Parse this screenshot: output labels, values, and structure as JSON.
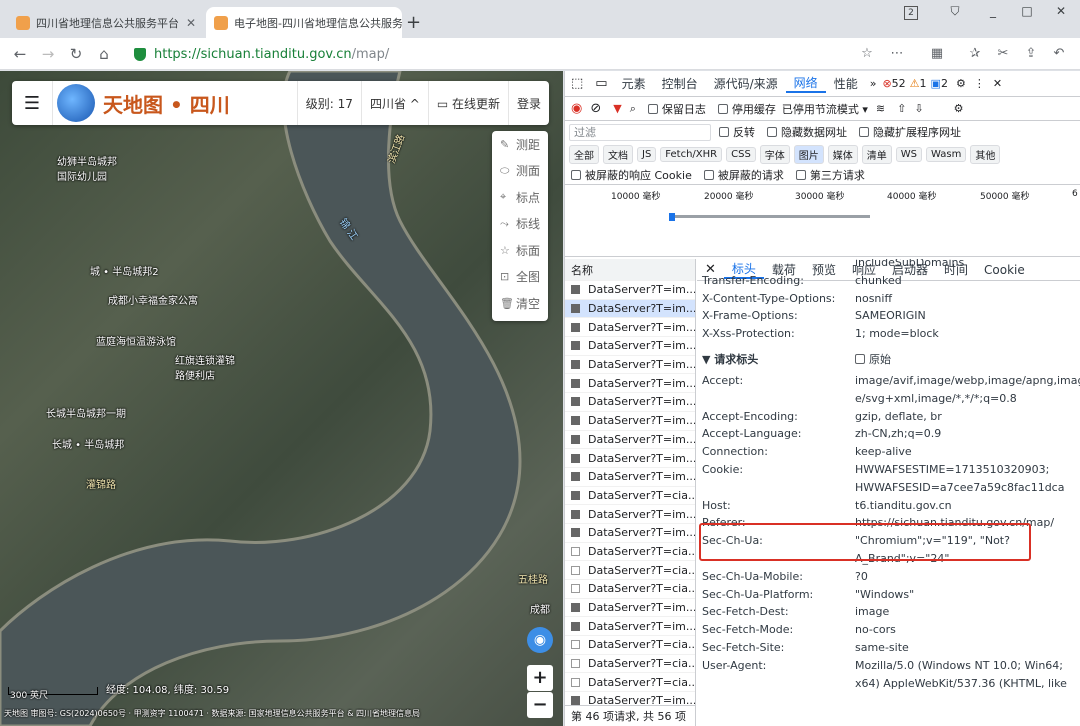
{
  "browser": {
    "tabs": [
      {
        "title": "四川省地理信息公共服务平台",
        "close": "✕"
      },
      {
        "title": "电子地图-四川省地理信息公共服务",
        "close": "✕"
      }
    ],
    "new_tab": "+",
    "url_scheme": "https://",
    "url_host": "sichuan.tianditu.gov.cn",
    "url_path": "/map/",
    "window_buttons": [
      "2",
      "_",
      "□",
      "✕"
    ]
  },
  "map": {
    "logo_text": "天地图 • 四川",
    "level_label": "级别: 17",
    "region": "四川省 ^",
    "update_button": "在线更新",
    "login_button": "登录",
    "tools": [
      "测距",
      "测面",
      "标点",
      "标线",
      "标面",
      "全图",
      "清空"
    ],
    "labels": [
      {
        "t": "幼狮半岛城邦",
        "c": "place"
      },
      {
        "t": "国际幼儿园",
        "c": "place"
      },
      {
        "t": "城 • 半岛城邦2",
        "c": "place"
      },
      {
        "t": "成都小幸福金家公寓",
        "c": "place"
      },
      {
        "t": "蓝庭海恒温游泳馆",
        "c": "place"
      },
      {
        "t": "红旗连锁灌锦",
        "c": "place"
      },
      {
        "t": "路便利店",
        "c": "place"
      },
      {
        "t": "长城半岛城邦一期",
        "c": "place"
      },
      {
        "t": "长城 • 半岛城邦",
        "c": "place"
      },
      {
        "t": "灌锦路",
        "c": "road"
      },
      {
        "t": "锦 江",
        "c": "road"
      },
      {
        "t": "滨江路",
        "c": "road"
      },
      {
        "t": "五桂路",
        "c": "road"
      },
      {
        "t": "成都",
        "c": "place"
      }
    ],
    "scale": "300 英尺",
    "coords": "经度: 104.08, 纬度: 30.59",
    "footer": "天地图 审图号: GS(2024)0650号 · 甲测资字 1100471 · 数据来源: 国家地理信息公共服务平台 & 四川省地理信息局",
    "zoom_in": "+",
    "zoom_out": "−"
  },
  "devtools": {
    "tabs": [
      "元素",
      "控制台",
      "源代码/来源",
      "网络",
      "性能"
    ],
    "active_tab": "网络",
    "badges": {
      "errors": "52",
      "warnings": "1",
      "info": "2"
    },
    "toolbar": {
      "preserve_log": "保留日志",
      "disable_cache": "停用缓存",
      "throttling": "已停用节流模式"
    },
    "filter_placeholder": "过滤",
    "filter_checks": [
      "反转",
      "隐藏数据网址",
      "隐藏扩展程序网址"
    ],
    "type_filters": [
      "全部",
      "文档",
      "JS",
      "Fetch/XHR",
      "CSS",
      "字体",
      "图片",
      "媒体",
      "清单",
      "WS",
      "Wasm",
      "其他"
    ],
    "active_type": "图片",
    "more_checks": [
      "被屏蔽的响应 Cookie",
      "被屏蔽的请求",
      "第三方请求"
    ],
    "timeline_ticks": [
      "10000 毫秒",
      "20000 毫秒",
      "30000 毫秒",
      "40000 毫秒",
      "50000 毫秒",
      "6"
    ],
    "name_header": "名称",
    "requests": [
      "DataServer?T=im...",
      "DataServer?T=im...",
      "DataServer?T=im...",
      "DataServer?T=im...",
      "DataServer?T=im...",
      "DataServer?T=im...",
      "DataServer?T=im...",
      "DataServer?T=im...",
      "DataServer?T=im...",
      "DataServer?T=im...",
      "DataServer?T=im...",
      "DataServer?T=cia...",
      "DataServer?T=im...",
      "DataServer?T=im...",
      "DataServer?T=cia...",
      "DataServer?T=cia...",
      "DataServer?T=cia...",
      "DataServer?T=im...",
      "DataServer?T=im...",
      "DataServer?T=cia...",
      "DataServer?T=cia...",
      "DataServer?T=cia...",
      "DataServer?T=im..."
    ],
    "detail_tabs": [
      "标头",
      "载荷",
      "预览",
      "响应",
      "启动器",
      "时间",
      "Cookie"
    ],
    "active_detail_tab": "标头",
    "response_headers": [
      {
        "k": "",
        "v": "includeSubDomains"
      },
      {
        "k": "Transfer-Encoding:",
        "v": "chunked"
      },
      {
        "k": "X-Content-Type-Options:",
        "v": "nosniff"
      },
      {
        "k": "X-Frame-Options:",
        "v": "SAMEORIGIN"
      },
      {
        "k": "X-Xss-Protection:",
        "v": "1; mode=block"
      }
    ],
    "request_section": "▼ 请求标头",
    "raw_label": "原始",
    "request_headers": [
      {
        "k": "Accept:",
        "v": "image/avif,image/webp,image/apng,imag",
        "v2": "e/svg+xml,image/*,*/*;q=0.8"
      },
      {
        "k": "Accept-Encoding:",
        "v": "gzip, deflate, br"
      },
      {
        "k": "Accept-Language:",
        "v": "zh-CN,zh;q=0.9"
      },
      {
        "k": "Connection:",
        "v": "keep-alive"
      },
      {
        "k": "Cookie:",
        "v": "HWWAFSESTIME=1713510320903;",
        "v2": "HWWAFSESID=a7cee7a59c8fac11dca"
      },
      {
        "k": "Host:",
        "v": "t6.tianditu.gov.cn"
      },
      {
        "k": "Referer:",
        "v": "https://sichuan.tianditu.gov.cn/map/"
      },
      {
        "k": "Sec-Ch-Ua:",
        "v": "\"Chromium\";v=\"119\", \"Not?",
        "v2": "A_Brand\";v=\"24\""
      },
      {
        "k": "Sec-Ch-Ua-Mobile:",
        "v": "?0"
      },
      {
        "k": "Sec-Ch-Ua-Platform:",
        "v": "\"Windows\""
      },
      {
        "k": "Sec-Fetch-Dest:",
        "v": "image"
      },
      {
        "k": "Sec-Fetch-Mode:",
        "v": "no-cors"
      },
      {
        "k": "Sec-Fetch-Site:",
        "v": "same-site"
      },
      {
        "k": "User-Agent:",
        "v": "Mozilla/5.0 (Windows NT 10.0; Win64;",
        "v2": "x64) AppleWebKit/537.36 (KHTML, like"
      }
    ],
    "status": "第 46 项请求, 共 56 项"
  }
}
